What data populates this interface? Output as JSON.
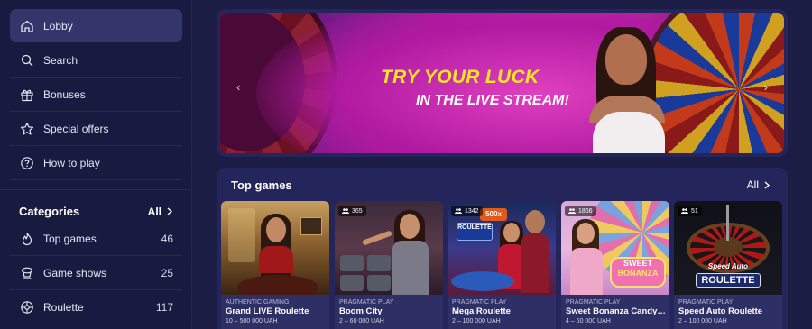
{
  "sidebar": {
    "nav": [
      {
        "label": "Lobby",
        "icon": "home-icon"
      },
      {
        "label": "Search",
        "icon": "search-icon"
      },
      {
        "label": "Bonuses",
        "icon": "gift-icon"
      },
      {
        "label": "Special offers",
        "icon": "star-icon"
      },
      {
        "label": "How to play",
        "icon": "help-icon"
      }
    ],
    "categories": {
      "title": "Categories",
      "all_label": "All",
      "items": [
        {
          "label": "Top games",
          "count": "46",
          "icon": "fire-icon"
        },
        {
          "label": "Game shows",
          "count": "25",
          "icon": "gameshow-icon"
        },
        {
          "label": "Roulette",
          "count": "117",
          "icon": "roulette-icon"
        }
      ]
    }
  },
  "banner": {
    "line1": "TRY YOUR LUCK",
    "line2": "IN THE LIVE STREAM!",
    "prev_icon": "chevron-left-icon",
    "next_icon": "chevron-right-icon"
  },
  "top_games": {
    "title": "Top games",
    "all_label": "All",
    "cards": [
      {
        "provider": "AUTHENTIC GAMING",
        "name": "Grand LIVE Roulette",
        "limits": "10 – 500 000 UAH",
        "players": ""
      },
      {
        "provider": "PRAGMATIC PLAY",
        "name": "Boom City",
        "limits": "2 – 60 000 UAH",
        "players": "365"
      },
      {
        "provider": "PRAGMATIC PLAY",
        "name": "Mega Roulette",
        "limits": "2 – 100 000 UAH",
        "players": "1342"
      },
      {
        "provider": "PRAGMATIC PLAY",
        "name": "Sweet Bonanza Candy…",
        "limits": "4 – 60 000 UAH",
        "players": "1866"
      },
      {
        "provider": "PRAGMATIC PLAY",
        "name": "Speed Auto Roulette",
        "limits": "2 – 100 000 UAH",
        "players": "51"
      }
    ],
    "thumb_texts": {
      "mega_multiplier": "500x",
      "mega_logo": "ROULETTE",
      "sweet_logo_1": "SWEET",
      "sweet_logo_2": "BONANZA",
      "speed_logo_1": "Speed Auto",
      "speed_logo_2": "ROULETTE"
    }
  },
  "colors": {
    "bg": "#1c1d45",
    "sidebar": "#191a3f",
    "active": "#34356a",
    "accent_yellow": "#f6e626"
  }
}
